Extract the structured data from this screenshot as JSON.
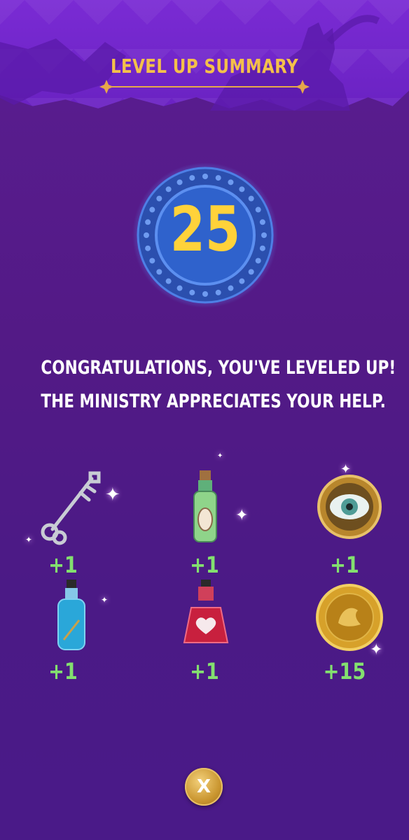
{
  "header": {
    "title": "LEVEL UP SUMMARY"
  },
  "level": {
    "value": "25"
  },
  "message": {
    "line1": "CONGRATULATIONS, YOU'VE LEVELED UP!",
    "line2": "THE MINISTRY APPRECIATES YOUR HELP."
  },
  "rewards": [
    {
      "icon": "key-icon",
      "amount": "+1"
    },
    {
      "icon": "brain-potion-icon",
      "amount": "+1"
    },
    {
      "icon": "eye-amulet-icon",
      "amount": "+1"
    },
    {
      "icon": "blue-potion-icon",
      "amount": "+1"
    },
    {
      "icon": "heart-potion-icon",
      "amount": "+1"
    },
    {
      "icon": "gold-coin-icon",
      "amount": "+15"
    }
  ],
  "buttons": {
    "close_label": "X"
  },
  "colors": {
    "background": "#531a86",
    "title_gold": "#f4c04a",
    "level_gold": "#ffd23a",
    "badge_blue": "#2f5fc8",
    "amount_green": "#83e06f"
  }
}
